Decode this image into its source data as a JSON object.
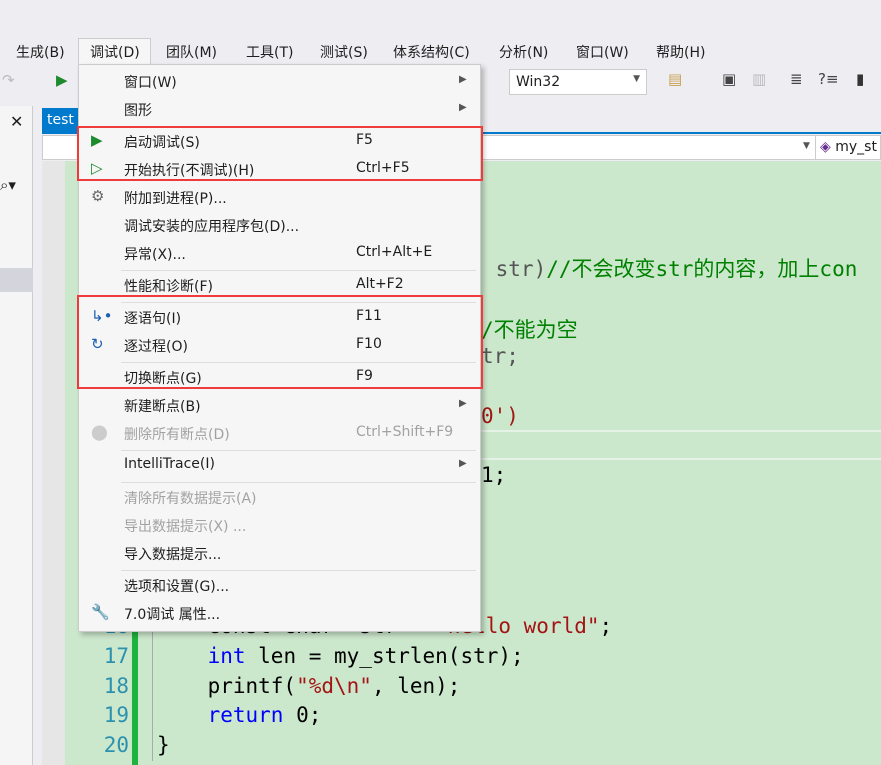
{
  "menubar": [
    "生成(B)",
    "调试(D)",
    "团队(M)",
    "工具(T)",
    "测试(S)",
    "体系结构(C)",
    "分析(N)",
    "窗口(W)",
    "帮助(H)"
  ],
  "toolbar": {
    "platform": "Win32"
  },
  "tab": {
    "label": "test"
  },
  "navbar": {
    "scope": "my_st"
  },
  "menu": {
    "window": {
      "label": "窗口(W)"
    },
    "graphics": {
      "label": "图形"
    },
    "start_debug": {
      "label": "启动调试(S)",
      "shortcut": "F5"
    },
    "start_no_debug": {
      "label": "开始执行(不调试)(H)",
      "shortcut": "Ctrl+F5"
    },
    "attach": {
      "label": "附加到进程(P)..."
    },
    "debug_pkg": {
      "label": "调试安装的应用程序包(D)..."
    },
    "exceptions": {
      "label": "异常(X)...",
      "shortcut": "Ctrl+Alt+E"
    },
    "perf": {
      "label": "性能和诊断(F)",
      "shortcut": "Alt+F2"
    },
    "step_into": {
      "label": "逐语句(I)",
      "shortcut": "F11"
    },
    "step_over": {
      "label": "逐过程(O)",
      "shortcut": "F10"
    },
    "toggle_bp": {
      "label": "切换断点(G)",
      "shortcut": "F9"
    },
    "new_bp": {
      "label": "新建断点(B)"
    },
    "delete_bp": {
      "label": "删除所有断点(D)",
      "shortcut": "Ctrl+Shift+F9"
    },
    "intellitrace": {
      "label": "IntelliTrace(I)"
    },
    "clear_tips": {
      "label": "清除所有数据提示(A)"
    },
    "export_tips": {
      "label": "导出数据提示(X) ..."
    },
    "import_tips": {
      "label": "导入数据提示..."
    },
    "options": {
      "label": "选项和设置(G)..."
    },
    "props": {
      "label": "7.0调试 属性..."
    }
  },
  "code": {
    "frag1a": " str)",
    "frag1b": "//不会改变str的内容，加上con",
    "frag2": "/不能为空",
    "frag3": "tr;",
    "frag4a": "0",
    "frag4b": "')",
    "frag5": "1;",
    "line_numbers": [
      "16",
      "17",
      "18",
      "19",
      "20"
    ],
    "l16a": "    const char* str = ",
    "l16b": "\"hello world\"",
    "l16c": ";",
    "l17a": "    ",
    "l17kw": "int",
    "l17b": " len = my_strlen(str);",
    "l18a": "    printf(",
    "l18s": "\"%d\\n\"",
    "l18b": ", len);",
    "l19a": "    ",
    "l19kw": "return",
    "l19b": " 0;",
    "l20": "}"
  }
}
